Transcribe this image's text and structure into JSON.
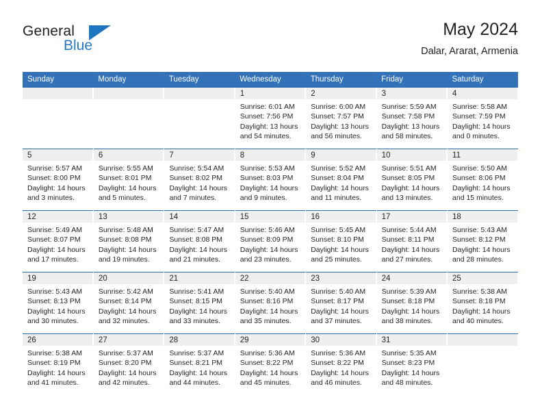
{
  "brand": {
    "name_part1": "General",
    "name_part2": "Blue",
    "triangle_icon": "triangle-icon",
    "colors": {
      "text": "#231f20",
      "blue": "#2579c4",
      "triangle": "#1f76c0"
    }
  },
  "header": {
    "title": "May 2024",
    "subtitle": "Dalar, Ararat, Armenia"
  },
  "theme": {
    "header_blue": "#3372B8",
    "row_divider_blue": "#2A6CB0",
    "daynum_strip_gray": "#EFEFEF",
    "text": "#231F20"
  },
  "calendar": {
    "weekday_headers": [
      "Sunday",
      "Monday",
      "Tuesday",
      "Wednesday",
      "Thursday",
      "Friday",
      "Saturday"
    ],
    "labels": {
      "sunrise": "Sunrise:",
      "sunset": "Sunset:",
      "daylight": "Daylight:"
    },
    "weeks": [
      [
        {
          "day": "",
          "empty": true
        },
        {
          "day": "",
          "empty": true
        },
        {
          "day": "",
          "empty": true
        },
        {
          "day": "1",
          "sunrise": "Sunrise: 6:01 AM",
          "sunset": "Sunset: 7:56 PM",
          "daylight_1": "Daylight: 13 hours",
          "daylight_2": "and 54 minutes."
        },
        {
          "day": "2",
          "sunrise": "Sunrise: 6:00 AM",
          "sunset": "Sunset: 7:57 PM",
          "daylight_1": "Daylight: 13 hours",
          "daylight_2": "and 56 minutes."
        },
        {
          "day": "3",
          "sunrise": "Sunrise: 5:59 AM",
          "sunset": "Sunset: 7:58 PM",
          "daylight_1": "Daylight: 13 hours",
          "daylight_2": "and 58 minutes."
        },
        {
          "day": "4",
          "sunrise": "Sunrise: 5:58 AM",
          "sunset": "Sunset: 7:59 PM",
          "daylight_1": "Daylight: 14 hours",
          "daylight_2": "and 0 minutes."
        }
      ],
      [
        {
          "day": "5",
          "sunrise": "Sunrise: 5:57 AM",
          "sunset": "Sunset: 8:00 PM",
          "daylight_1": "Daylight: 14 hours",
          "daylight_2": "and 3 minutes."
        },
        {
          "day": "6",
          "sunrise": "Sunrise: 5:55 AM",
          "sunset": "Sunset: 8:01 PM",
          "daylight_1": "Daylight: 14 hours",
          "daylight_2": "and 5 minutes."
        },
        {
          "day": "7",
          "sunrise": "Sunrise: 5:54 AM",
          "sunset": "Sunset: 8:02 PM",
          "daylight_1": "Daylight: 14 hours",
          "daylight_2": "and 7 minutes."
        },
        {
          "day": "8",
          "sunrise": "Sunrise: 5:53 AM",
          "sunset": "Sunset: 8:03 PM",
          "daylight_1": "Daylight: 14 hours",
          "daylight_2": "and 9 minutes."
        },
        {
          "day": "9",
          "sunrise": "Sunrise: 5:52 AM",
          "sunset": "Sunset: 8:04 PM",
          "daylight_1": "Daylight: 14 hours",
          "daylight_2": "and 11 minutes."
        },
        {
          "day": "10",
          "sunrise": "Sunrise: 5:51 AM",
          "sunset": "Sunset: 8:05 PM",
          "daylight_1": "Daylight: 14 hours",
          "daylight_2": "and 13 minutes."
        },
        {
          "day": "11",
          "sunrise": "Sunrise: 5:50 AM",
          "sunset": "Sunset: 8:06 PM",
          "daylight_1": "Daylight: 14 hours",
          "daylight_2": "and 15 minutes."
        }
      ],
      [
        {
          "day": "12",
          "sunrise": "Sunrise: 5:49 AM",
          "sunset": "Sunset: 8:07 PM",
          "daylight_1": "Daylight: 14 hours",
          "daylight_2": "and 17 minutes."
        },
        {
          "day": "13",
          "sunrise": "Sunrise: 5:48 AM",
          "sunset": "Sunset: 8:08 PM",
          "daylight_1": "Daylight: 14 hours",
          "daylight_2": "and 19 minutes."
        },
        {
          "day": "14",
          "sunrise": "Sunrise: 5:47 AM",
          "sunset": "Sunset: 8:08 PM",
          "daylight_1": "Daylight: 14 hours",
          "daylight_2": "and 21 minutes."
        },
        {
          "day": "15",
          "sunrise": "Sunrise: 5:46 AM",
          "sunset": "Sunset: 8:09 PM",
          "daylight_1": "Daylight: 14 hours",
          "daylight_2": "and 23 minutes."
        },
        {
          "day": "16",
          "sunrise": "Sunrise: 5:45 AM",
          "sunset": "Sunset: 8:10 PM",
          "daylight_1": "Daylight: 14 hours",
          "daylight_2": "and 25 minutes."
        },
        {
          "day": "17",
          "sunrise": "Sunrise: 5:44 AM",
          "sunset": "Sunset: 8:11 PM",
          "daylight_1": "Daylight: 14 hours",
          "daylight_2": "and 27 minutes."
        },
        {
          "day": "18",
          "sunrise": "Sunrise: 5:43 AM",
          "sunset": "Sunset: 8:12 PM",
          "daylight_1": "Daylight: 14 hours",
          "daylight_2": "and 28 minutes."
        }
      ],
      [
        {
          "day": "19",
          "sunrise": "Sunrise: 5:43 AM",
          "sunset": "Sunset: 8:13 PM",
          "daylight_1": "Daylight: 14 hours",
          "daylight_2": "and 30 minutes."
        },
        {
          "day": "20",
          "sunrise": "Sunrise: 5:42 AM",
          "sunset": "Sunset: 8:14 PM",
          "daylight_1": "Daylight: 14 hours",
          "daylight_2": "and 32 minutes."
        },
        {
          "day": "21",
          "sunrise": "Sunrise: 5:41 AM",
          "sunset": "Sunset: 8:15 PM",
          "daylight_1": "Daylight: 14 hours",
          "daylight_2": "and 33 minutes."
        },
        {
          "day": "22",
          "sunrise": "Sunrise: 5:40 AM",
          "sunset": "Sunset: 8:16 PM",
          "daylight_1": "Daylight: 14 hours",
          "daylight_2": "and 35 minutes."
        },
        {
          "day": "23",
          "sunrise": "Sunrise: 5:40 AM",
          "sunset": "Sunset: 8:17 PM",
          "daylight_1": "Daylight: 14 hours",
          "daylight_2": "and 37 minutes."
        },
        {
          "day": "24",
          "sunrise": "Sunrise: 5:39 AM",
          "sunset": "Sunset: 8:18 PM",
          "daylight_1": "Daylight: 14 hours",
          "daylight_2": "and 38 minutes."
        },
        {
          "day": "25",
          "sunrise": "Sunrise: 5:38 AM",
          "sunset": "Sunset: 8:18 PM",
          "daylight_1": "Daylight: 14 hours",
          "daylight_2": "and 40 minutes."
        }
      ],
      [
        {
          "day": "26",
          "sunrise": "Sunrise: 5:38 AM",
          "sunset": "Sunset: 8:19 PM",
          "daylight_1": "Daylight: 14 hours",
          "daylight_2": "and 41 minutes."
        },
        {
          "day": "27",
          "sunrise": "Sunrise: 5:37 AM",
          "sunset": "Sunset: 8:20 PM",
          "daylight_1": "Daylight: 14 hours",
          "daylight_2": "and 42 minutes."
        },
        {
          "day": "28",
          "sunrise": "Sunrise: 5:37 AM",
          "sunset": "Sunset: 8:21 PM",
          "daylight_1": "Daylight: 14 hours",
          "daylight_2": "and 44 minutes."
        },
        {
          "day": "29",
          "sunrise": "Sunrise: 5:36 AM",
          "sunset": "Sunset: 8:22 PM",
          "daylight_1": "Daylight: 14 hours",
          "daylight_2": "and 45 minutes."
        },
        {
          "day": "30",
          "sunrise": "Sunrise: 5:36 AM",
          "sunset": "Sunset: 8:22 PM",
          "daylight_1": "Daylight: 14 hours",
          "daylight_2": "and 46 minutes."
        },
        {
          "day": "31",
          "sunrise": "Sunrise: 5:35 AM",
          "sunset": "Sunset: 8:23 PM",
          "daylight_1": "Daylight: 14 hours",
          "daylight_2": "and 48 minutes."
        },
        {
          "day": "",
          "empty": true
        }
      ]
    ]
  }
}
